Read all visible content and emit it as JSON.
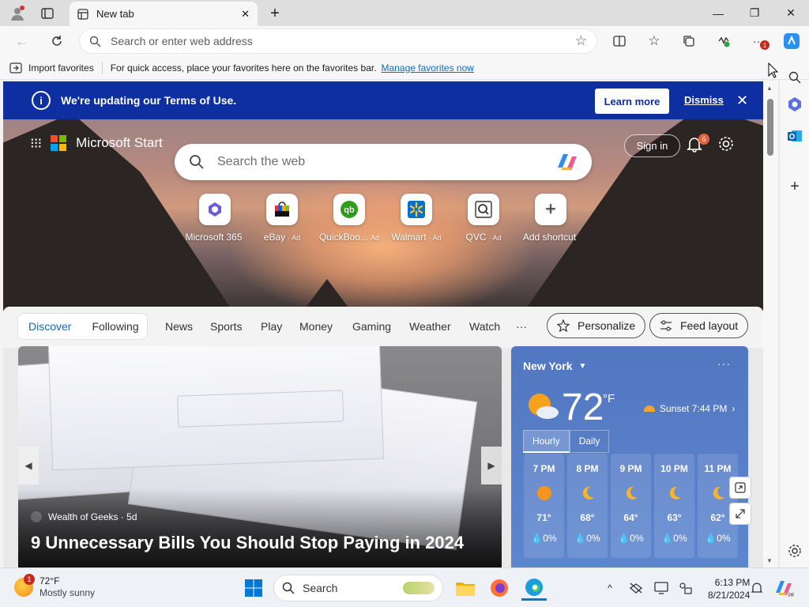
{
  "browser": {
    "tab_title": "New tab",
    "address_placeholder": "Search or enter web address",
    "notification_count": "1"
  },
  "favorites_bar": {
    "import_label": "Import favorites",
    "message": "For quick access, place your favorites here on the favorites bar.",
    "manage_link": "Manage favorites now"
  },
  "terms_banner": {
    "message": "We're updating our Terms of Use.",
    "learn_more": "Learn more",
    "dismiss": "Dismiss"
  },
  "start": {
    "brand": "Microsoft Start",
    "search_placeholder": "Search the web",
    "sign_in": "Sign in",
    "bell_count": "6",
    "shortcuts": [
      {
        "label": "Microsoft 365",
        "ad": ""
      },
      {
        "label": "eBay",
        "ad": "· Ad"
      },
      {
        "label": "QuickBoo...",
        "ad": "Ad"
      },
      {
        "label": "Walmart",
        "ad": "· Ad"
      },
      {
        "label": "QVC",
        "ad": "· Ad"
      },
      {
        "label": "Add shortcut",
        "ad": ""
      }
    ]
  },
  "feed_nav": {
    "discover": "Discover",
    "following": "Following",
    "tabs": [
      "News",
      "Sports",
      "Play",
      "Money",
      "Gaming",
      "Weather",
      "Watch"
    ],
    "more": "···",
    "personalize": "Personalize",
    "feed_layout": "Feed layout"
  },
  "news_card": {
    "source": "Wealth of Geeks · 5d",
    "headline": "9 Unnecessary Bills You Should Stop Paying in 2024"
  },
  "weather": {
    "location": "New York",
    "temperature": "72",
    "unit": "°F",
    "sunset": "Sunset 7:44 PM",
    "tab_hourly": "Hourly",
    "tab_daily": "Daily",
    "hours": [
      {
        "time": "7 PM",
        "temp": "71°",
        "precip": "0%",
        "icon": "sun-icon"
      },
      {
        "time": "8 PM",
        "temp": "68°",
        "precip": "0%",
        "icon": "moon-icon"
      },
      {
        "time": "9 PM",
        "temp": "64°",
        "precip": "0%",
        "icon": "moon-icon"
      },
      {
        "time": "10 PM",
        "temp": "63°",
        "precip": "0%",
        "icon": "moon-icon"
      },
      {
        "time": "11 PM",
        "temp": "62°",
        "precip": "0%",
        "icon": "moon-icon"
      }
    ]
  },
  "taskbar": {
    "weather_temp": "72°F",
    "weather_desc": "Mostly sunny",
    "weather_badge": "1",
    "search_label": "Search",
    "time": "6:13 PM",
    "date": "8/21/2024"
  },
  "colors": {
    "banner": "#0e2fa2",
    "accent": "#0f6cbd",
    "weather_card": "#5277c1"
  }
}
